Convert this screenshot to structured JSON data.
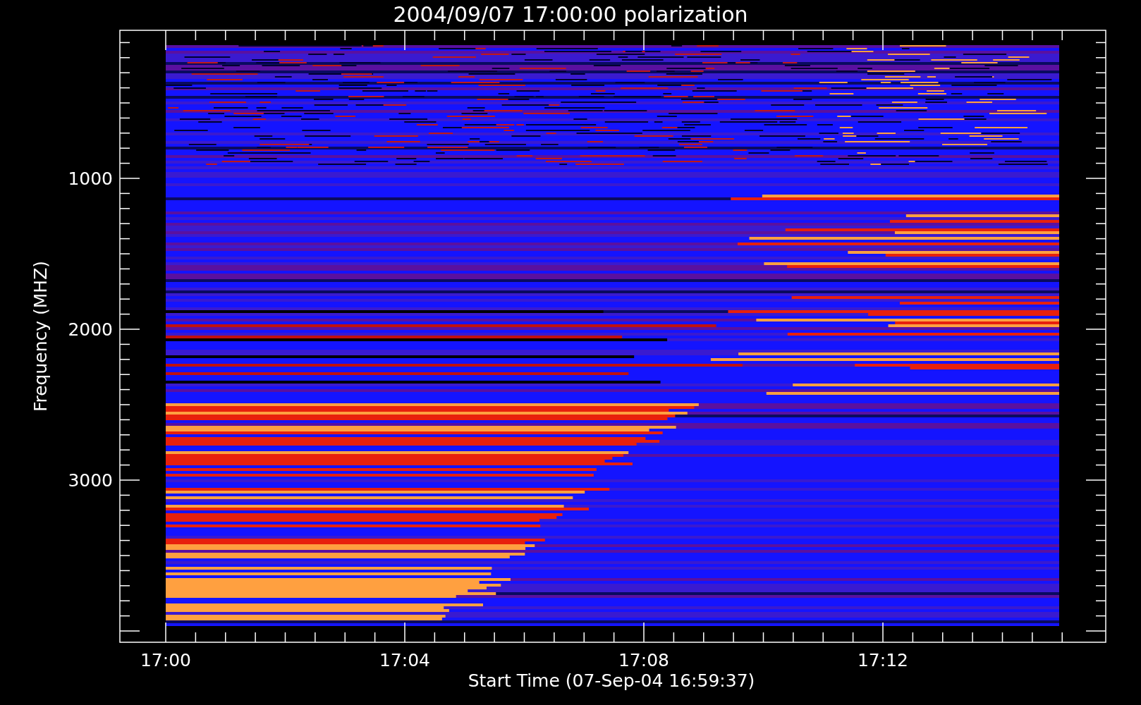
{
  "title": "2004/09/07 17:00:00 polarization",
  "y_axis": {
    "label": "Frequency (MHZ)",
    "ticks": [
      "1000",
      "2000",
      "3000"
    ]
  },
  "x_axis": {
    "label": "Start Time (07-Sep-04 16:59:37)",
    "ticks": [
      "17:00",
      "17:04",
      "17:08",
      "17:12"
    ]
  }
}
